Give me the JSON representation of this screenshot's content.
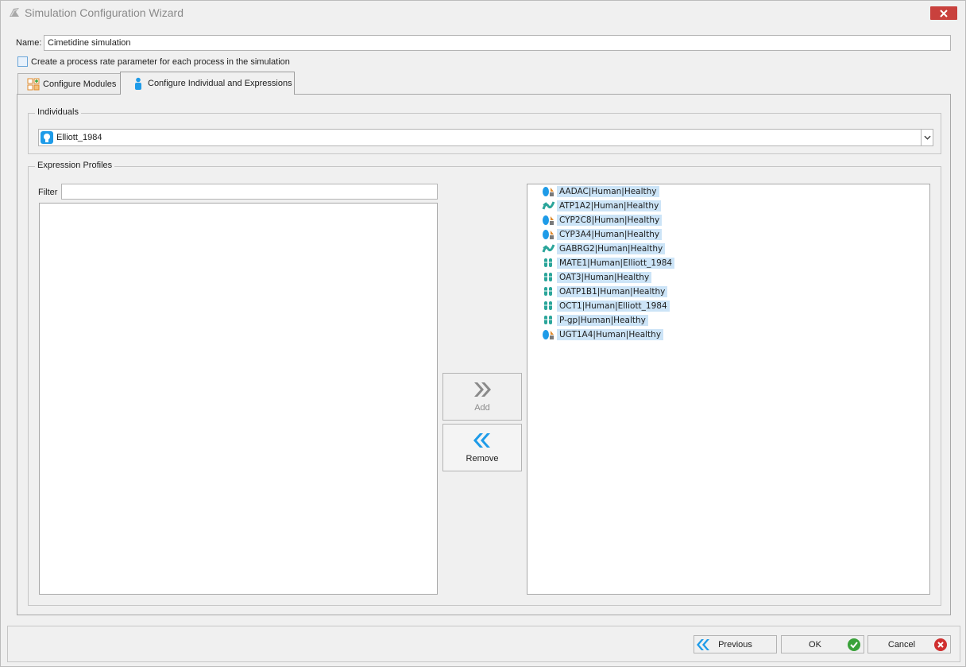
{
  "window": {
    "title": "Simulation Configuration Wizard"
  },
  "form": {
    "name_label": "Name:",
    "name_value": "Cimetidine simulation",
    "checkbox_label": "Create a process rate parameter for each process in the simulation",
    "checkbox_checked": false
  },
  "tabs": [
    {
      "label": "Configure Modules",
      "active": false
    },
    {
      "label": "Configure Individual and Expressions",
      "active": true
    }
  ],
  "individuals": {
    "group_title": "Individuals",
    "selected": "Elliott_1984"
  },
  "expression_profiles": {
    "group_title": "Expression Profiles",
    "filter_label": "Filter",
    "filter_value": "",
    "add_label": "Add",
    "remove_label": "Remove",
    "selected": [
      {
        "label": "AADAC|Human|Healthy",
        "kind": "enzyme"
      },
      {
        "label": "ATP1A2|Human|Healthy",
        "kind": "protein"
      },
      {
        "label": "CYP2C8|Human|Healthy",
        "kind": "enzyme"
      },
      {
        "label": "CYP3A4|Human|Healthy",
        "kind": "enzyme"
      },
      {
        "label": "GABRG2|Human|Healthy",
        "kind": "protein"
      },
      {
        "label": "MATE1|Human|Elliott_1984",
        "kind": "transporter"
      },
      {
        "label": "OAT3|Human|Healthy",
        "kind": "transporter"
      },
      {
        "label": "OATP1B1|Human|Healthy",
        "kind": "transporter"
      },
      {
        "label": "OCT1|Human|Elliott_1984",
        "kind": "transporter"
      },
      {
        "label": "P-gp|Human|Healthy",
        "kind": "transporter"
      },
      {
        "label": "UGT1A4|Human|Healthy",
        "kind": "enzyme"
      }
    ]
  },
  "footer": {
    "previous_label": "Previous",
    "ok_label": "OK",
    "cancel_label": "Cancel"
  },
  "colors": {
    "accent_blue": "#1e9be8",
    "ok_green": "#3aa23a",
    "cancel_red": "#d03030",
    "selection": "#cce4f7"
  }
}
